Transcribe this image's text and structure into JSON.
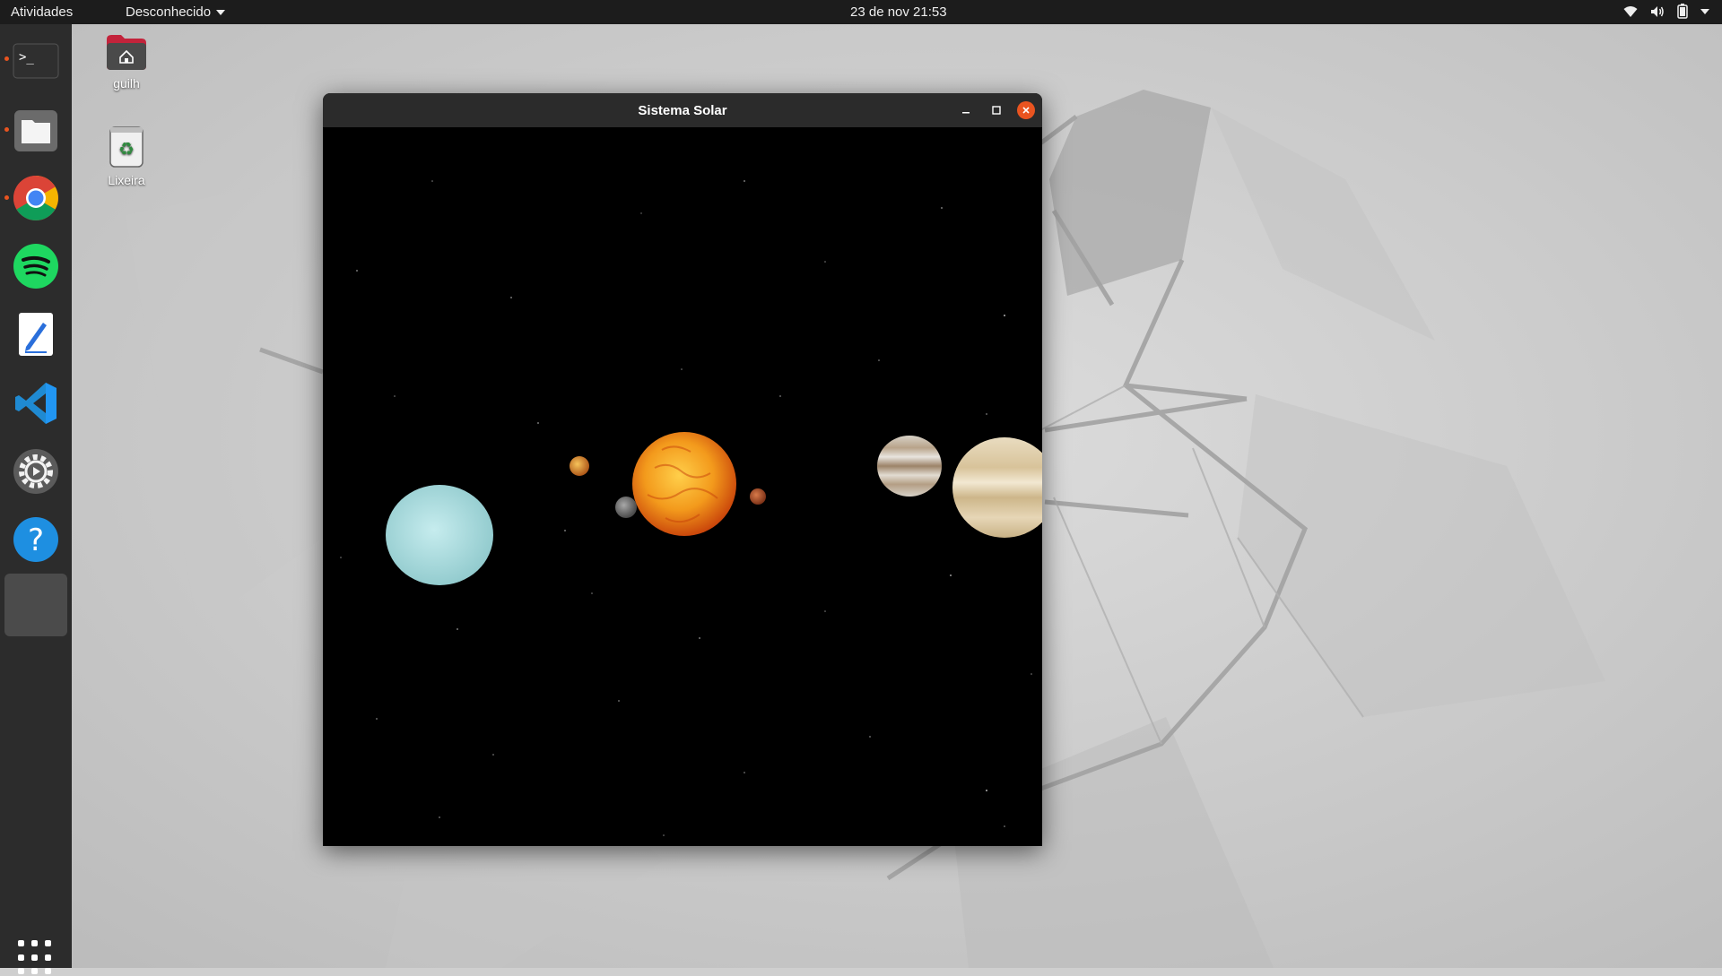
{
  "topbar": {
    "activities": "Atividades",
    "app_menu": "Desconhecido",
    "clock": "23 de nov  21:53",
    "tray_icons": [
      "wifi-icon",
      "volume-icon",
      "battery-icon",
      "system-menu-chevron-icon"
    ]
  },
  "dock": {
    "apps": [
      {
        "name": "terminal",
        "icon": "terminal-icon",
        "running": true
      },
      {
        "name": "files",
        "icon": "files-icon",
        "running": true
      },
      {
        "name": "chrome",
        "icon": "chrome-icon",
        "running": true
      },
      {
        "name": "spotify",
        "icon": "spotify-icon",
        "running": false
      },
      {
        "name": "text-editor",
        "icon": "text-editor-icon",
        "running": false
      },
      {
        "name": "vscode",
        "icon": "vscode-icon",
        "running": false
      },
      {
        "name": "settings",
        "icon": "settings-icon",
        "running": false
      },
      {
        "name": "help",
        "icon": "help-icon",
        "running": false
      },
      {
        "name": "unknown-app",
        "icon": "blank-app-icon",
        "running": true,
        "active": true
      }
    ],
    "show_apps_icon": "app-grid-icon"
  },
  "desktop": {
    "icons": [
      {
        "label": "guilh",
        "icon": "home-folder-icon"
      },
      {
        "label": "Lixeira",
        "icon": "trash-icon"
      }
    ]
  },
  "window": {
    "title": "Sistema Solar",
    "controls": [
      "minimize-icon",
      "maximize-icon",
      "close-icon"
    ],
    "scene": {
      "background": "#000000",
      "bodies": [
        "sun",
        "mercury",
        "venus",
        "mars",
        "jupiter",
        "saturn",
        "uranus"
      ]
    }
  },
  "colors": {
    "accent": "#e95420",
    "topbar": "#1c1c1c",
    "dock": "#2c2c2c",
    "titlebar": "#2b2b2b"
  }
}
